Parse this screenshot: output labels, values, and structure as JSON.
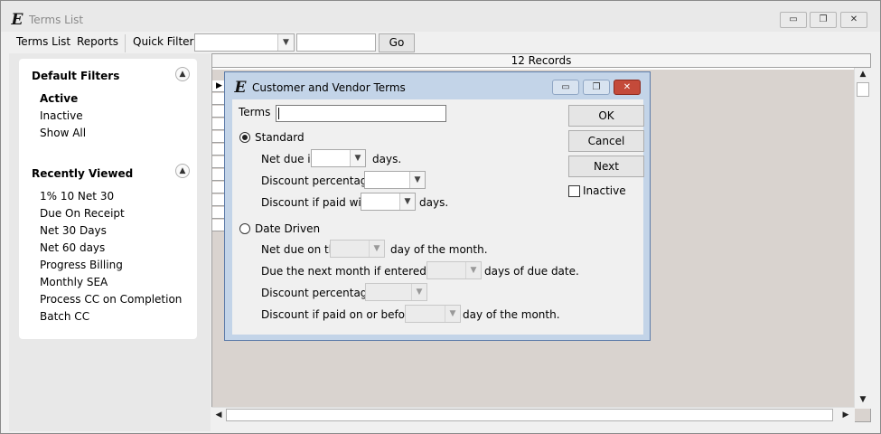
{
  "window": {
    "title": "Terms List",
    "controls": {
      "minimize": "▭",
      "restore": "❐",
      "close": "✕"
    }
  },
  "menubar": {
    "terms_list": "Terms List",
    "reports": "Reports",
    "quick_filter_label": "Quick Filter",
    "quick_filter_value": "",
    "quick_filter_text": "",
    "go": "Go"
  },
  "left": {
    "default_filters": {
      "title": "Default Filters",
      "items": [
        "Active",
        "Inactive",
        "Show All"
      ]
    },
    "recently_viewed": {
      "title": "Recently Viewed",
      "items": [
        "1% 10 Net 30",
        "Due On Receipt",
        "Net 30 Days",
        "Net 60 days",
        "Progress Billing",
        "Monthly SEA",
        "Process CC on Completion",
        "Batch CC"
      ]
    }
  },
  "grid": {
    "records": "12 Records"
  },
  "dialog": {
    "title": "Customer and Vendor Terms",
    "terms_label": "Terms",
    "terms_value": "",
    "standard": {
      "label": "Standard",
      "net_due_in": "Net due in",
      "days": "days.",
      "discount_percentage": "Discount percentage is",
      "discount_if_paid_within": "Discount if paid within",
      "days2": "days."
    },
    "date_driven": {
      "label": "Date Driven",
      "net_due_on_the": "Net due on the",
      "day_of_month": "day of the month.",
      "due_next_month": "Due the next month if entered within",
      "days_of_due_date": "days of due date.",
      "discount_percentage": "Discount percentage is",
      "discount_if_paid_on_or_before": "Discount if paid on or before the",
      "day_of_month2": "day of the month."
    },
    "buttons": {
      "ok": "OK",
      "cancel": "Cancel",
      "next": "Next"
    },
    "inactive_label": "Inactive"
  }
}
